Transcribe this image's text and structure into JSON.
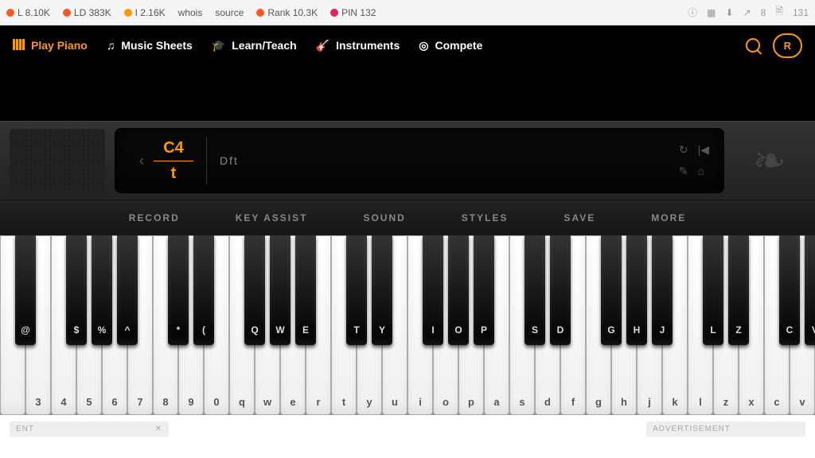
{
  "toolbar": {
    "items": [
      {
        "dot": "#ff5722",
        "label": "L 8.10K"
      },
      {
        "dot": "#ff5722",
        "label": "LD 383K"
      },
      {
        "dot": "#ff9800",
        "label": "I 2.16K"
      },
      {
        "dot": "",
        "label": "whois"
      },
      {
        "dot": "",
        "label": "source"
      },
      {
        "dot": "#ff5722",
        "label": "Rank 10.3K"
      },
      {
        "dot": "#e91e63",
        "label": "PIN 132"
      }
    ],
    "right": [
      "8",
      "131"
    ]
  },
  "nav": {
    "items": [
      {
        "label": "Play Piano",
        "active": true,
        "icon": "piano-icon"
      },
      {
        "label": "Music Sheets",
        "active": false,
        "icon": "music-note-icon"
      },
      {
        "label": "Learn/Teach",
        "active": false,
        "icon": "grad-cap-icon"
      },
      {
        "label": "Instruments",
        "active": false,
        "icon": "guitar-icon"
      },
      {
        "label": "Compete",
        "active": false,
        "icon": "target-icon"
      }
    ],
    "btn": "R"
  },
  "display": {
    "note": "C4",
    "key": "t",
    "text": "Dft",
    "icons": {
      "row1": [
        "↻",
        "|◀"
      ],
      "row2": [
        "✎",
        "⌂"
      ]
    }
  },
  "controls": [
    "RECORD",
    "KEY ASSIST",
    "SOUND",
    "STYLES",
    "SAVE",
    "MORE"
  ],
  "keyboard": {
    "whites": [
      "",
      "3",
      "4",
      "5",
      "6",
      "7",
      "8",
      "9",
      "0",
      "q",
      "w",
      "e",
      "r",
      "t",
      "y",
      "u",
      "i",
      "o",
      "p",
      "a",
      "s",
      "d",
      "f",
      "g",
      "h",
      "j",
      "k",
      "l",
      "z",
      "x",
      "c",
      "v"
    ],
    "blacks": [
      {
        "pos": 0,
        "label": "@"
      },
      {
        "pos": 2,
        "label": "$"
      },
      {
        "pos": 3,
        "label": "%"
      },
      {
        "pos": 4,
        "label": "^"
      },
      {
        "pos": 6,
        "label": "*"
      },
      {
        "pos": 7,
        "label": "("
      },
      {
        "pos": 9,
        "label": "Q"
      },
      {
        "pos": 10,
        "label": "W"
      },
      {
        "pos": 11,
        "label": "E"
      },
      {
        "pos": 13,
        "label": "T"
      },
      {
        "pos": 14,
        "label": "Y"
      },
      {
        "pos": 16,
        "label": "I"
      },
      {
        "pos": 17,
        "label": "O"
      },
      {
        "pos": 18,
        "label": "P"
      },
      {
        "pos": 20,
        "label": "S"
      },
      {
        "pos": 21,
        "label": "D"
      },
      {
        "pos": 23,
        "label": "G"
      },
      {
        "pos": 24,
        "label": "H"
      },
      {
        "pos": 25,
        "label": "J"
      },
      {
        "pos": 27,
        "label": "L"
      },
      {
        "pos": 28,
        "label": "Z"
      },
      {
        "pos": 30,
        "label": "C"
      },
      {
        "pos": 31,
        "label": "V"
      }
    ]
  },
  "ads": {
    "left": "ENT",
    "right": "ADVERTISEMENT",
    "close": "✕"
  }
}
